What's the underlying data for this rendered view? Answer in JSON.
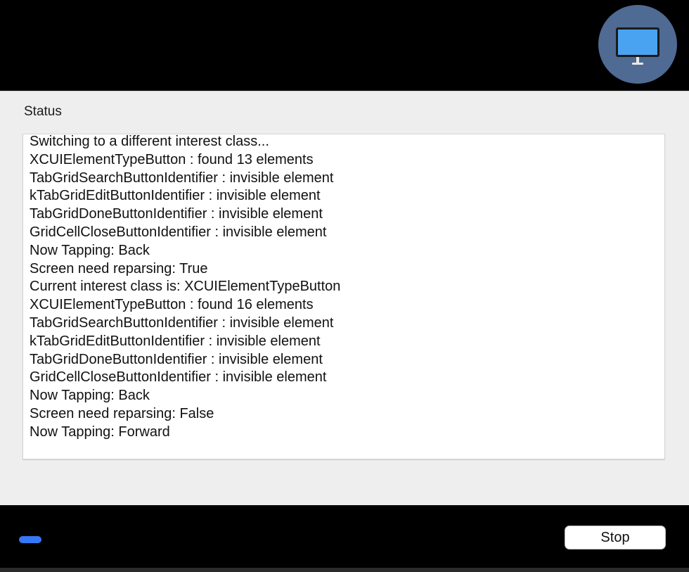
{
  "header": {
    "avatar_icon": "monitor-icon",
    "avatar_color": "#4f6a93",
    "monitor_color": "#4aa3f0"
  },
  "status": {
    "label": "Status",
    "log_lines": [
      "Switching to a different interest class...",
      "XCUIElementTypeButton : found 13 elements",
      "TabGridSearchButtonIdentifier : invisible element",
      "kTabGridEditButtonIdentifier : invisible element",
      "TabGridDoneButtonIdentifier : invisible element",
      "GridCellCloseButtonIdentifier : invisible element",
      "Now Tapping: Back",
      "Screen need reparsing: True",
      "Current interest class is: XCUIElementTypeButton",
      "XCUIElementTypeButton : found 16 elements",
      "TabGridSearchButtonIdentifier : invisible element",
      "kTabGridEditButtonIdentifier : invisible element",
      "TabGridDoneButtonIdentifier : invisible element",
      "GridCellCloseButtonIdentifier : invisible element",
      "Now Tapping: Back",
      "Screen need reparsing: False",
      "Now Tapping: Forward"
    ]
  },
  "footer": {
    "indicator_color": "#3478f6",
    "stop_label": "Stop"
  }
}
